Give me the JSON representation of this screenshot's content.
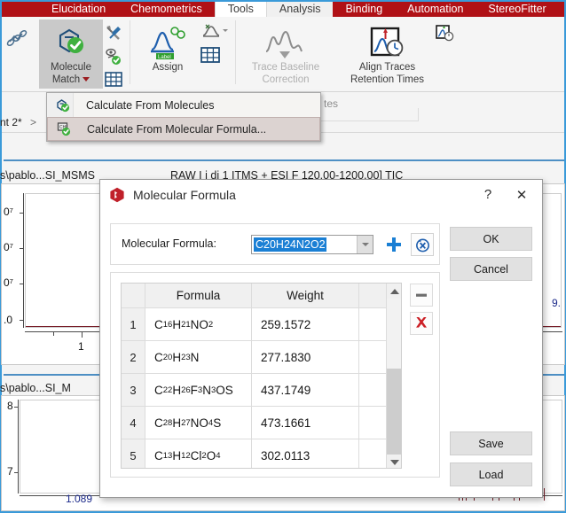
{
  "ribbon": {
    "tabs": [
      {
        "label": "Elucidation",
        "state": "red"
      },
      {
        "label": "Chemometrics",
        "state": "red"
      },
      {
        "label": "Tools",
        "state": "active"
      },
      {
        "label": "Analysis",
        "state": "selected"
      },
      {
        "label": "Binding",
        "state": "red"
      },
      {
        "label": "Automation",
        "state": "red"
      },
      {
        "label": "StereoFitter",
        "state": "red"
      }
    ],
    "groups": [
      {
        "buttons": [
          {
            "label_line1": "Molecule",
            "label_line2": "Match",
            "icon": "molecule-check-icon",
            "state": "pressed",
            "has_dropdown": true
          }
        ],
        "small_buttons": [
          {
            "icon": "tools-wrench-screwdriver-icon"
          },
          {
            "icon": "molecule-eye-check-icon"
          },
          {
            "icon": "grid-table-icon"
          }
        ]
      },
      {
        "buttons": [
          {
            "label_line1": "Assign",
            "label_line2": "",
            "icon": "peak-label-icon",
            "state": "normal"
          }
        ],
        "small_buttons": [
          {
            "icon": "peak-cluster-icon"
          },
          {
            "icon": "grid-table-icon"
          }
        ]
      },
      {
        "buttons": [
          {
            "label_line1": "Trace Baseline",
            "label_line2": "Correction",
            "icon": "trace-baseline-icon",
            "state": "disabled"
          }
        ],
        "small_buttons": []
      },
      {
        "buttons": [
          {
            "label_line1": "Align Traces",
            "label_line2": "Retention Times",
            "icon": "align-traces-clock-icon",
            "state": "normal"
          }
        ],
        "small_buttons": [
          {
            "icon": "align-small-clock-icon"
          }
        ]
      }
    ]
  },
  "menu": {
    "items": [
      {
        "label": "Calculate From Molecules",
        "icon": "molecule-check-icon",
        "highlighted": false
      },
      {
        "label": "Calculate From Molecular Formula...",
        "icon": "formula-check-icon",
        "highlighted": true
      }
    ],
    "truncated_background_label": "tes"
  },
  "background": {
    "breadcrumb": "nt 2*",
    "breadcrumb_chevron": ">",
    "pane1_title": "s\\pablo...SI_MSMS",
    "pane1_title_full_visible": "RAW  I   i    di      1 ITMS  +    ESI F     120.00-1200.00] TIC",
    "pane2_title": "s\\pablo...SI_M",
    "pane1_y_ticks": [
      "0⁷",
      "0⁷",
      "0⁷",
      ".0"
    ],
    "pane1_x_tick": "1",
    "pane2_y_ticks": [
      "8",
      "7"
    ],
    "pane2_x_value": "1.089",
    "pane_right_value": "9."
  },
  "dialog": {
    "title": "Molecular Formula",
    "icon": "app-red-badge-icon",
    "help_button": "?",
    "close_button": "✕",
    "formula_field": {
      "label": "Molecular Formula:",
      "value": "C20H24N2O2",
      "selected": true
    },
    "add_button_icon": "blue-plus-icon",
    "reset_button_icon": "blue-reset-circle-icon",
    "minus_button_icon": "gray-minus-icon",
    "delete_button_icon": "red-x-icon",
    "buttons": {
      "ok": "OK",
      "cancel": "Cancel",
      "save": "Save",
      "load": "Load"
    },
    "table": {
      "columns": [
        "",
        "Formula",
        "Weight",
        ""
      ],
      "rows": [
        {
          "index": "1",
          "formula_html": "C<sub>16</sub>H<sub>21</sub>NO<sub>2</sub>",
          "formula_text": "C16H21NO2",
          "weight": "259.1572"
        },
        {
          "index": "2",
          "formula_html": "C<sub>20</sub>H<sub>23</sub>N",
          "formula_text": "C20H23N",
          "weight": "277.1830"
        },
        {
          "index": "3",
          "formula_html": "C<sub>22</sub>H<sub>26</sub>F<sub>3</sub>N<sub>3</sub>OS",
          "formula_text": "C22H26F3N3OS",
          "weight": "437.1749"
        },
        {
          "index": "4",
          "formula_html": "C<sub>28</sub>H<sub>27</sub>NO<sub>4</sub>S",
          "formula_text": "C28H27NO4S",
          "weight": "473.1661"
        },
        {
          "index": "5",
          "formula_html": "C<sub>13</sub>H<sub>12</sub>Cl<sub>2</sub>O<sub>4</sub>",
          "formula_text": "C13H12Cl2O4",
          "weight": "302.0113"
        }
      ]
    }
  },
  "colors": {
    "ribbon_red": "#b01116",
    "accent_blue": "#1a7fd4",
    "selection_blue": "#1a7fd4",
    "window_border": "#3a9ad9",
    "danger_red": "#cc2027",
    "trace_maroon": "#7a1f2a"
  }
}
